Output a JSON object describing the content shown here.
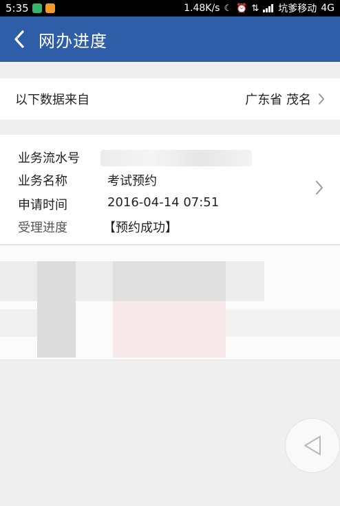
{
  "status_bar": {
    "time": "5:35",
    "speed": "1.48K/s",
    "carrier": "坑爹移动",
    "network": "4G"
  },
  "header": {
    "title": "网办进度"
  },
  "source": {
    "label": "以下数据来自",
    "location": "广东省 茂名"
  },
  "record": {
    "serial_label": "业务流水号",
    "name_label": "业务名称",
    "name_value": "考试预约",
    "time_label": "申请时间",
    "time_value": "2016-04-14 07:51",
    "progress_label": "受理进度",
    "progress_value": "【预约成功】"
  },
  "colors": {
    "header_bg": "#2f5ea8",
    "status_bg": "#000000",
    "page_bg": "#efefef"
  }
}
